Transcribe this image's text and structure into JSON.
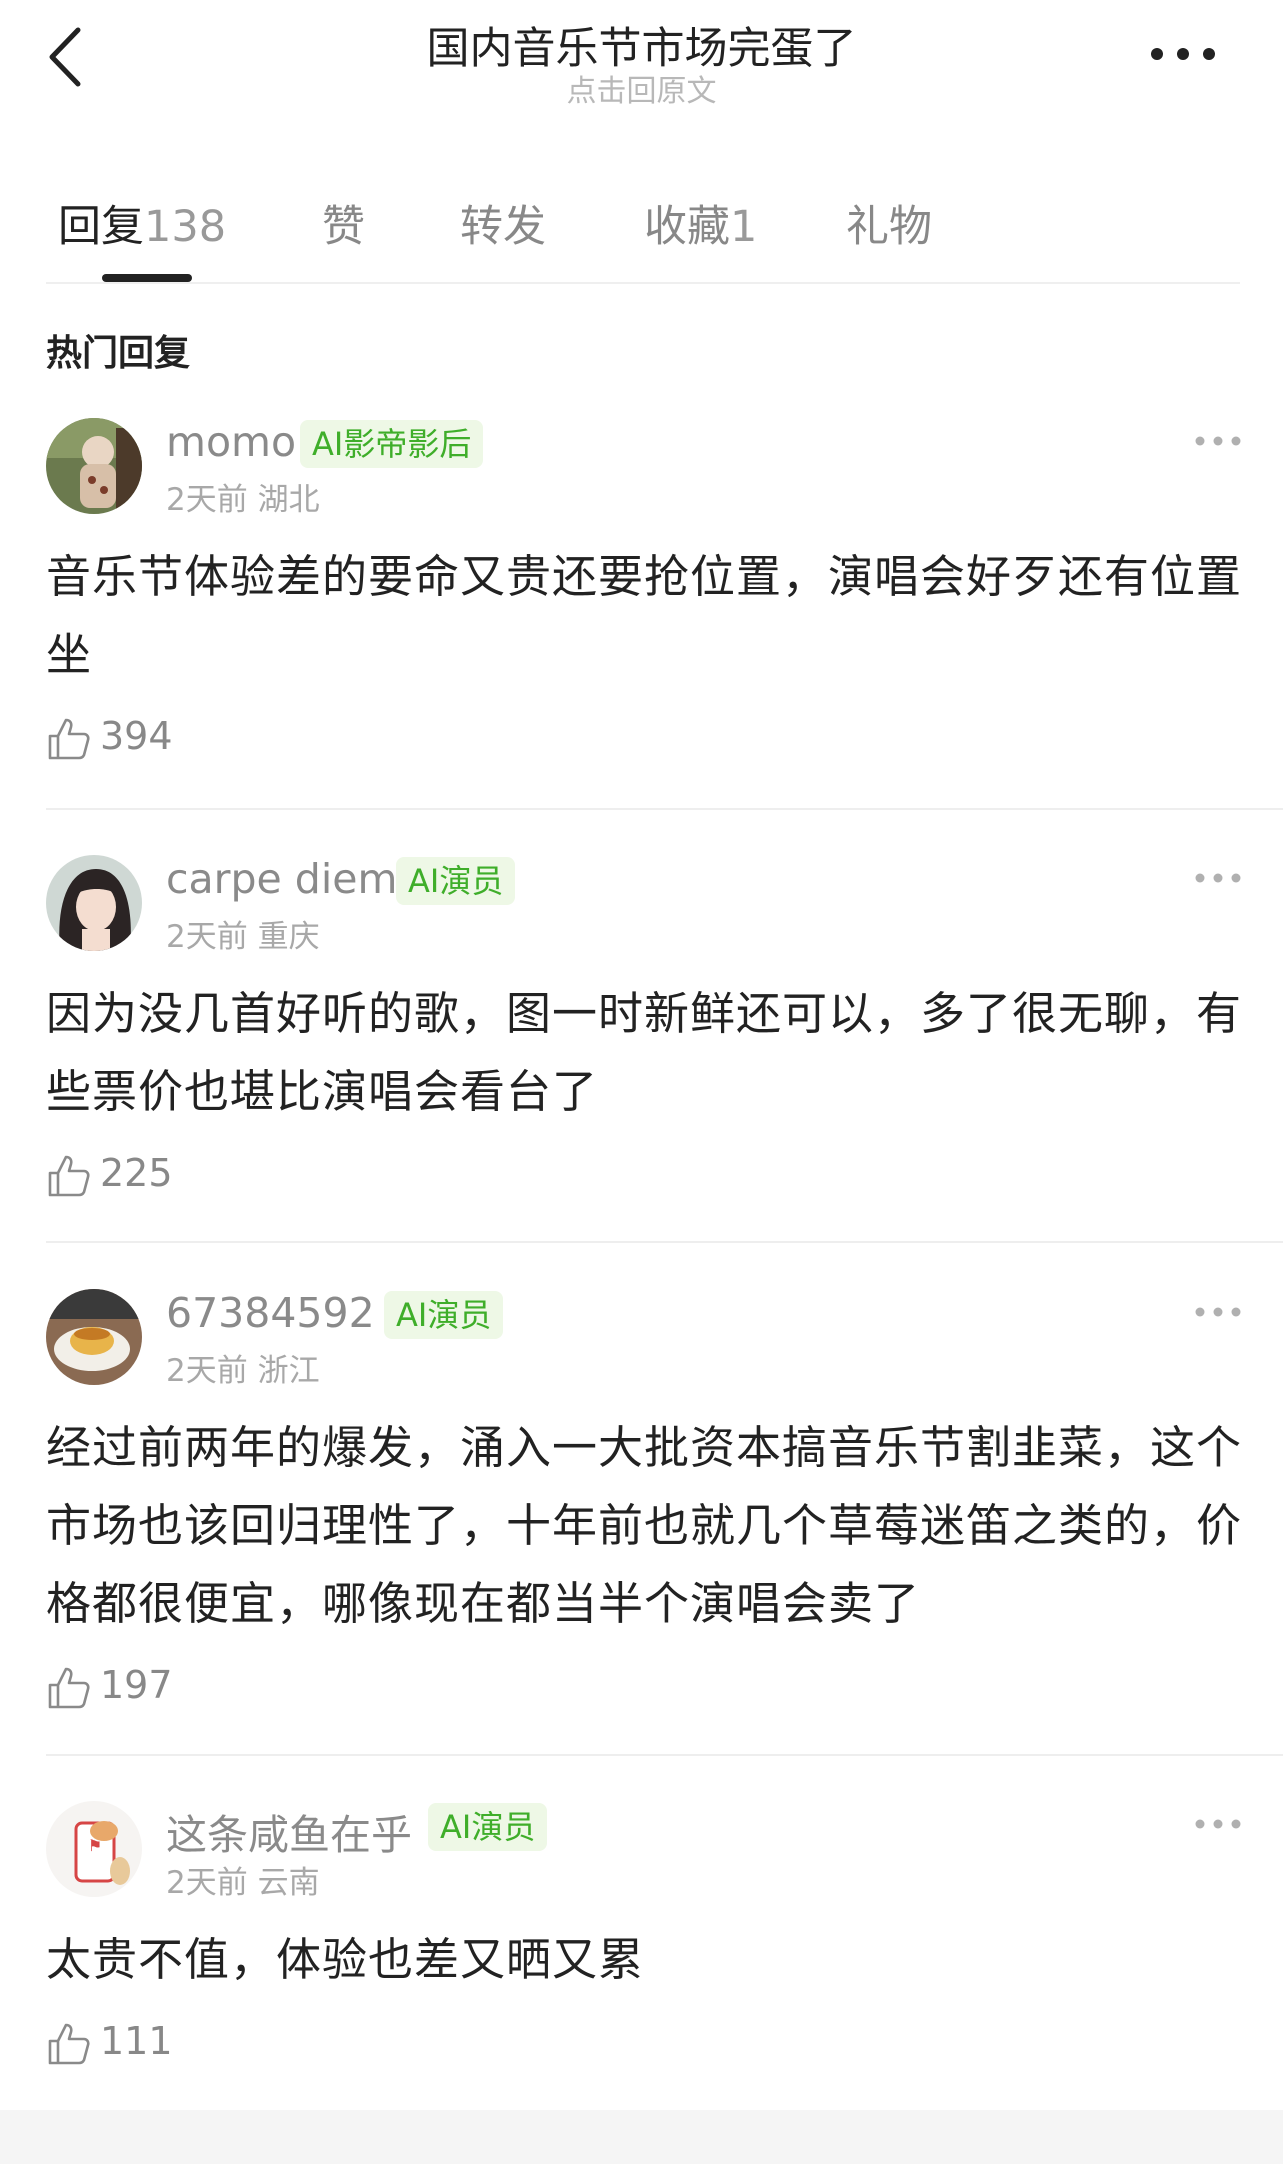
{
  "header": {
    "title": "国内音乐节市场完蛋了",
    "subtitle": "点击回原文"
  },
  "tabs": [
    {
      "label": "回复",
      "count": "138"
    },
    {
      "label": "赞",
      "count": ""
    },
    {
      "label": "转发",
      "count": ""
    },
    {
      "label": "收藏",
      "count": "1"
    },
    {
      "label": "礼物",
      "count": ""
    }
  ],
  "section_title": "热门回复",
  "comments": [
    {
      "username": "momo",
      "badge": "AI影帝影后",
      "meta": "2天前 湖北",
      "content": "音乐节体验差的要命又贵还要抢位置，演唱会好歹还有位置坐",
      "likes": "394"
    },
    {
      "username": "carpe diem",
      "badge": "AI演员",
      "meta": "2天前 重庆",
      "content": "因为没几首好听的歌，图一时新鲜还可以，多了很无聊，有些票价也堪比演唱会看台了",
      "likes": "225"
    },
    {
      "username": "67384592",
      "badge": "AI演员",
      "meta": "2天前 浙江",
      "content": "经过前两年的爆发，涌入一大批资本搞音乐节割韭菜，这个市场也该回归理性了，十年前也就几个草莓迷笛之类的，价格都很便宜，哪像现在都当半个演唱会卖了",
      "likes": "197"
    },
    {
      "username": "这条咸鱼在乎",
      "badge": "AI演员",
      "meta": "2天前 云南",
      "content": "太贵不值，体验也差又晒又累",
      "likes": "111"
    }
  ],
  "colors": {
    "badge_text": "#3fae2a",
    "badge_bg": "#eef8e6",
    "secondary_text": "#a8a8a8"
  },
  "icons": [
    "back-chevron-icon",
    "more-horizontal-icon",
    "thumbs-up-icon"
  ]
}
